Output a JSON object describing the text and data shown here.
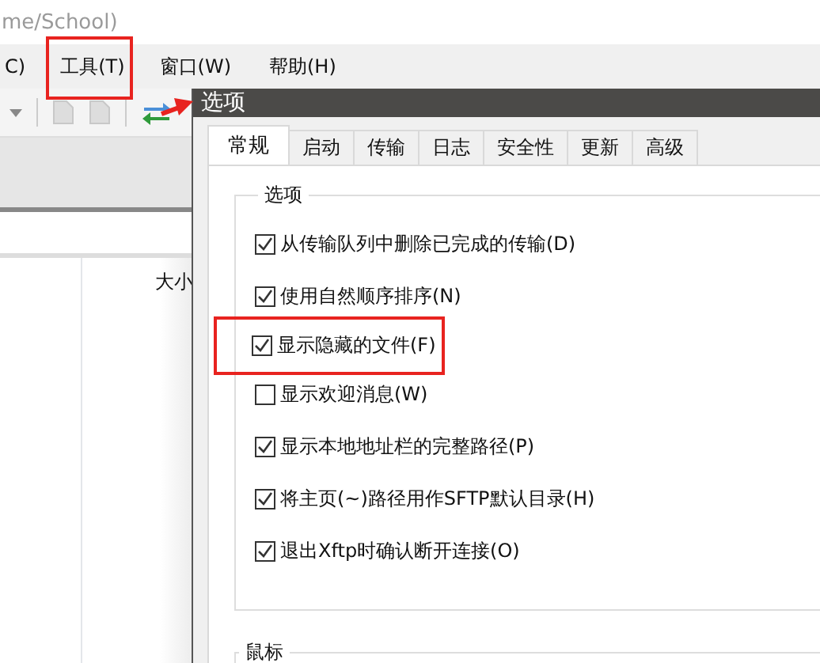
{
  "app": {
    "title": "me/School)",
    "menu": [
      {
        "label": "C)",
        "highlighted": false
      },
      {
        "label": "工具(T)",
        "highlighted": true
      },
      {
        "label": "窗口(W)",
        "highlighted": false
      },
      {
        "label": "帮助(H)",
        "highlighted": false
      }
    ],
    "column_header": "大小"
  },
  "dialog": {
    "title": "选项",
    "tabs": [
      {
        "label": "常规",
        "selected": true
      },
      {
        "label": "启动",
        "selected": false
      },
      {
        "label": "传输",
        "selected": false
      },
      {
        "label": "日志",
        "selected": false
      },
      {
        "label": "安全性",
        "selected": false
      },
      {
        "label": "更新",
        "selected": false
      },
      {
        "label": "高级",
        "selected": false
      }
    ],
    "options_group": {
      "title": "选项",
      "options": [
        {
          "label": "从传输队列中删除已完成的传输(D)",
          "checked": true,
          "highlighted": false
        },
        {
          "label": "使用自然顺序排序(N)",
          "checked": true,
          "highlighted": false
        },
        {
          "label": "显示隐藏的文件(F)",
          "checked": true,
          "highlighted": true
        },
        {
          "label": "显示欢迎消息(W)",
          "checked": false,
          "highlighted": false
        },
        {
          "label": "显示本地地址栏的完整路径(P)",
          "checked": true,
          "highlighted": false
        },
        {
          "label": "将主页(~)路径用作SFTP默认目录(H)",
          "checked": true,
          "highlighted": false
        },
        {
          "label": "退出Xftp时确认断开连接(O)",
          "checked": true,
          "highlighted": false
        }
      ]
    },
    "mouse_group": {
      "title": "鼠标"
    }
  }
}
